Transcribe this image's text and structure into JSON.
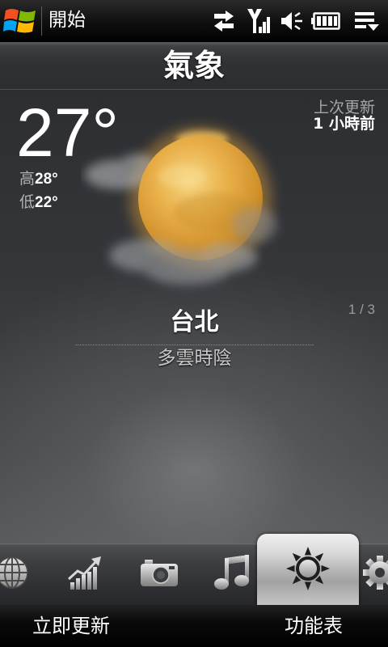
{
  "status_bar": {
    "start_label": "開始",
    "logo_icon": "windows-logo-icon",
    "icons": {
      "sync": "sync-icon",
      "signal": "signal-icon",
      "speaker": "speaker-icon",
      "battery": "battery-icon",
      "menu": "menu-icon"
    }
  },
  "app": {
    "title": "氣象"
  },
  "weather": {
    "current_temp": "27°",
    "high": {
      "label": "高",
      "value": "28°"
    },
    "low": {
      "label": "低",
      "value": "22°"
    },
    "last_updated": {
      "label": "上次更新",
      "value": "1 小時前"
    },
    "condition_icon": "sun-with-clouds-icon",
    "page_indicator": "1 / 3",
    "city": "台北",
    "condition": "多雲時陰"
  },
  "tabs": {
    "selected_index": 4,
    "items": [
      {
        "icon": "globe-icon"
      },
      {
        "icon": "stocks-chart-icon"
      },
      {
        "icon": "camera-icon"
      },
      {
        "icon": "music-icon"
      },
      {
        "icon": "weather-sun-icon",
        "selected": true
      },
      {
        "icon": "settings-gear-icon"
      }
    ]
  },
  "softkeys": {
    "left": "立即更新",
    "right": "功能表"
  },
  "colors": {
    "background": "#3a3c40",
    "sun": "#e9b04a",
    "text_primary": "#ffffff",
    "text_secondary": "#a6a6a6",
    "selected_tab": "#d6d6d6"
  }
}
